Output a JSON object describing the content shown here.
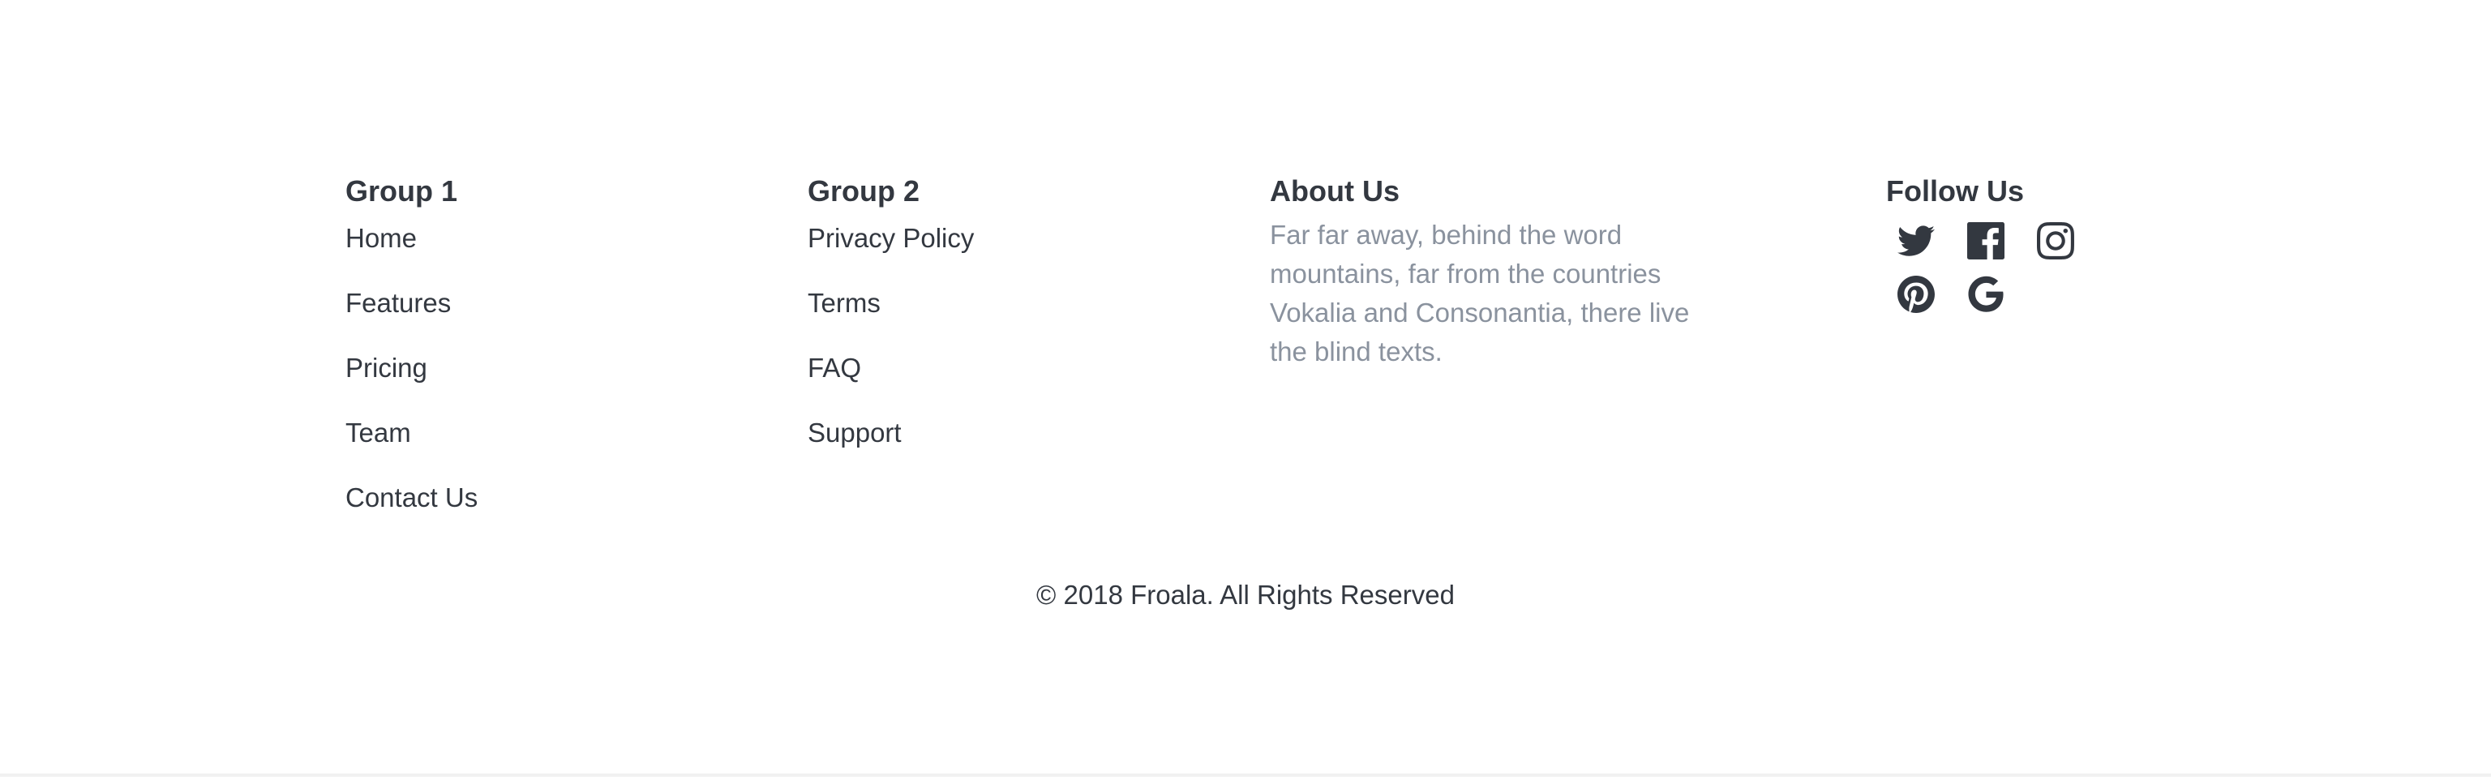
{
  "group1": {
    "title": "Group 1",
    "links": [
      "Home",
      "Features",
      "Pricing",
      "Team",
      "Contact Us"
    ]
  },
  "group2": {
    "title": "Group 2",
    "links": [
      "Privacy Policy",
      "Terms",
      "FAQ",
      "Support"
    ]
  },
  "about": {
    "title": "About Us",
    "text": "Far far away, behind the word mountains, far from the countries Vokalia and Consonantia, there live the blind texts."
  },
  "follow": {
    "title": "Follow Us",
    "icons": [
      "twitter-icon",
      "facebook-icon",
      "instagram-icon",
      "pinterest-icon",
      "google-icon"
    ]
  },
  "copyright": "© 2018 Froala. All Rights Reserved",
  "colors": {
    "text": "#333840",
    "muted": "#8a929e",
    "background": "#ffffff"
  }
}
